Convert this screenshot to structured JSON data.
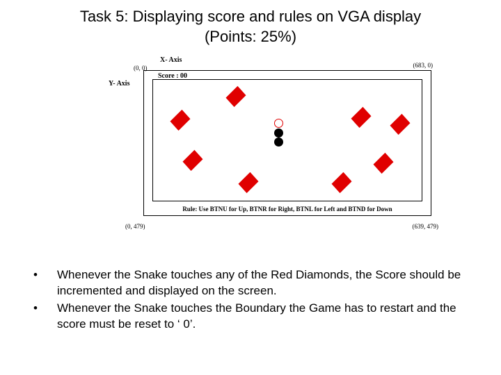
{
  "title_line1": "Task 5: Displaying score and rules on VGA display",
  "title_line2": "(Points: 25%)",
  "figure": {
    "axis_x": "X- Axis",
    "axis_y": "Y- Axis",
    "coord_tl": "(0, 0)",
    "coord_tr": "(683, 0)",
    "coord_bl": "(0, 479)",
    "coord_br": "(639, 479)",
    "score": "Score : 00",
    "rule": "Rule: Use BTNU for Up, BTNR for Right, BTNL for Left and BTND for Down"
  },
  "bullets": [
    "Whenever the Snake touches any of the Red Diamonds, the Score should be incremented and displayed on the screen.",
    "Whenever the Snake touches the Boundary the Game has to restart and the score must be reset to ‘ 0’."
  ]
}
